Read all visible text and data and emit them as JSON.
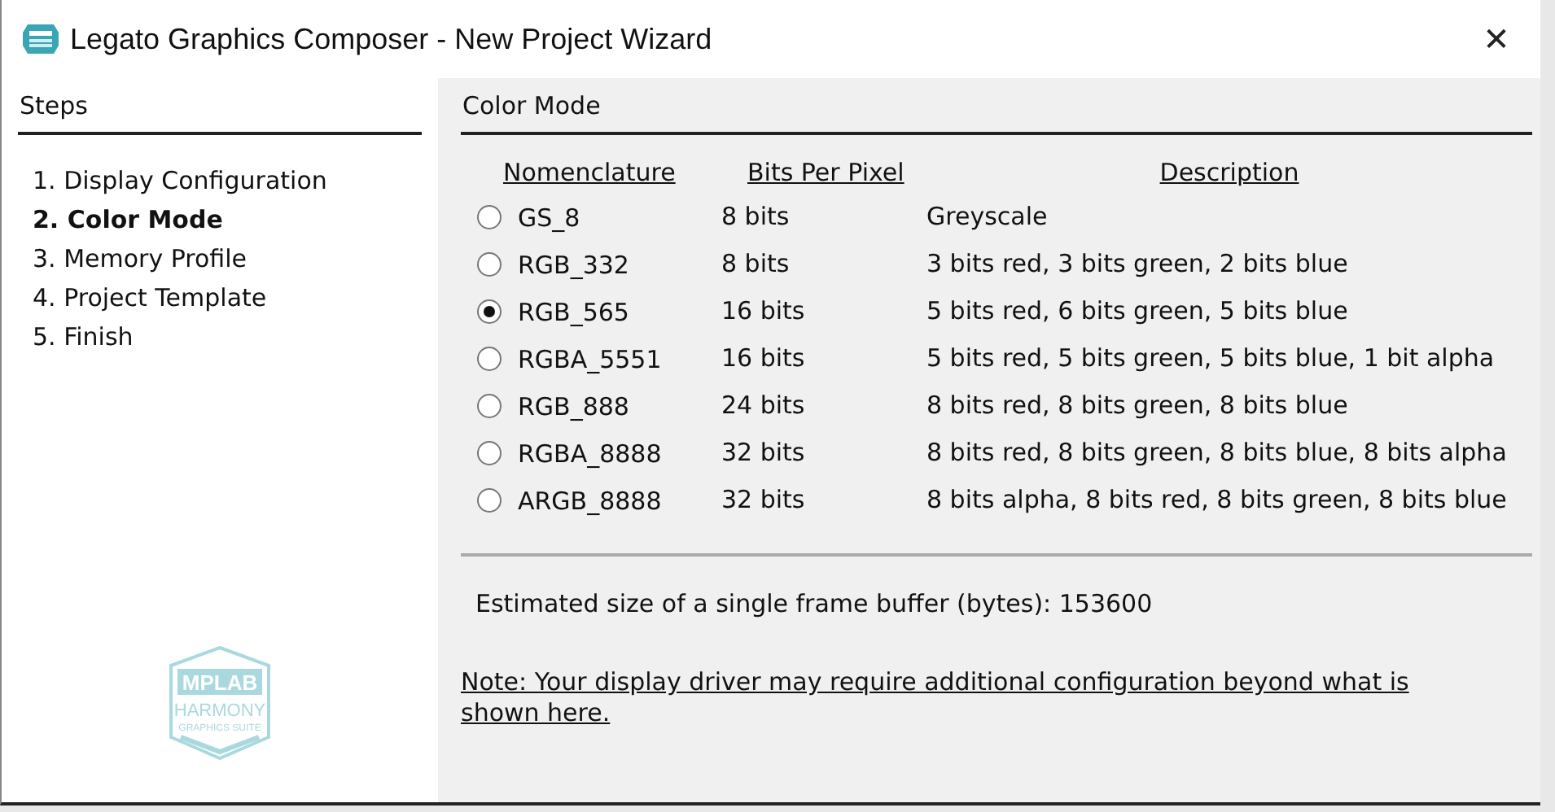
{
  "window": {
    "title": "Legato Graphics Composer - New Project Wizard",
    "close_label": "✕"
  },
  "steps_panel": {
    "heading": "Steps",
    "items": [
      {
        "number": "1.",
        "label": "Display Configuration",
        "selected": false
      },
      {
        "number": "2.",
        "label": "Color Mode",
        "selected": true
      },
      {
        "number": "3.",
        "label": "Memory Profile",
        "selected": false
      },
      {
        "number": "4.",
        "label": "Project Template",
        "selected": false
      },
      {
        "number": "5.",
        "label": "Finish",
        "selected": false
      }
    ],
    "logo": {
      "lines": [
        "MPLAB",
        "HARMONY",
        "GRAPHICS SUITE"
      ]
    }
  },
  "color_mode": {
    "heading": "Color Mode",
    "columns": [
      "Nomenclature",
      "Bits Per Pixel",
      "Description"
    ],
    "rows": [
      {
        "name": "GS_8",
        "bits": "8 bits",
        "description": "Greyscale",
        "selected": false
      },
      {
        "name": "RGB_332",
        "bits": "8 bits",
        "description": "3 bits red, 3 bits green, 2 bits blue",
        "selected": false
      },
      {
        "name": "RGB_565",
        "bits": "16 bits",
        "description": "5 bits red, 6 bits green, 5 bits blue",
        "selected": true
      },
      {
        "name": "RGBA_5551",
        "bits": "16 bits",
        "description": "5 bits red, 5 bits green, 5 bits blue, 1 bit alpha",
        "selected": false
      },
      {
        "name": "RGB_888",
        "bits": "24 bits",
        "description": "8 bits red, 8 bits green, 8 bits blue",
        "selected": false
      },
      {
        "name": "RGBA_8888",
        "bits": "32 bits",
        "description": "8 bits red, 8 bits green, 8 bits blue, 8 bits alpha",
        "selected": false
      },
      {
        "name": "ARGB_8888",
        "bits": "32 bits",
        "description": "8 bits alpha, 8 bits red, 8 bits green, 8 bits blue",
        "selected": false
      }
    ],
    "estimate": "Estimated size of a single frame buffer (bytes): 153600",
    "note": "Note: Your display driver may require additional configuration beyond what is shown here."
  }
}
